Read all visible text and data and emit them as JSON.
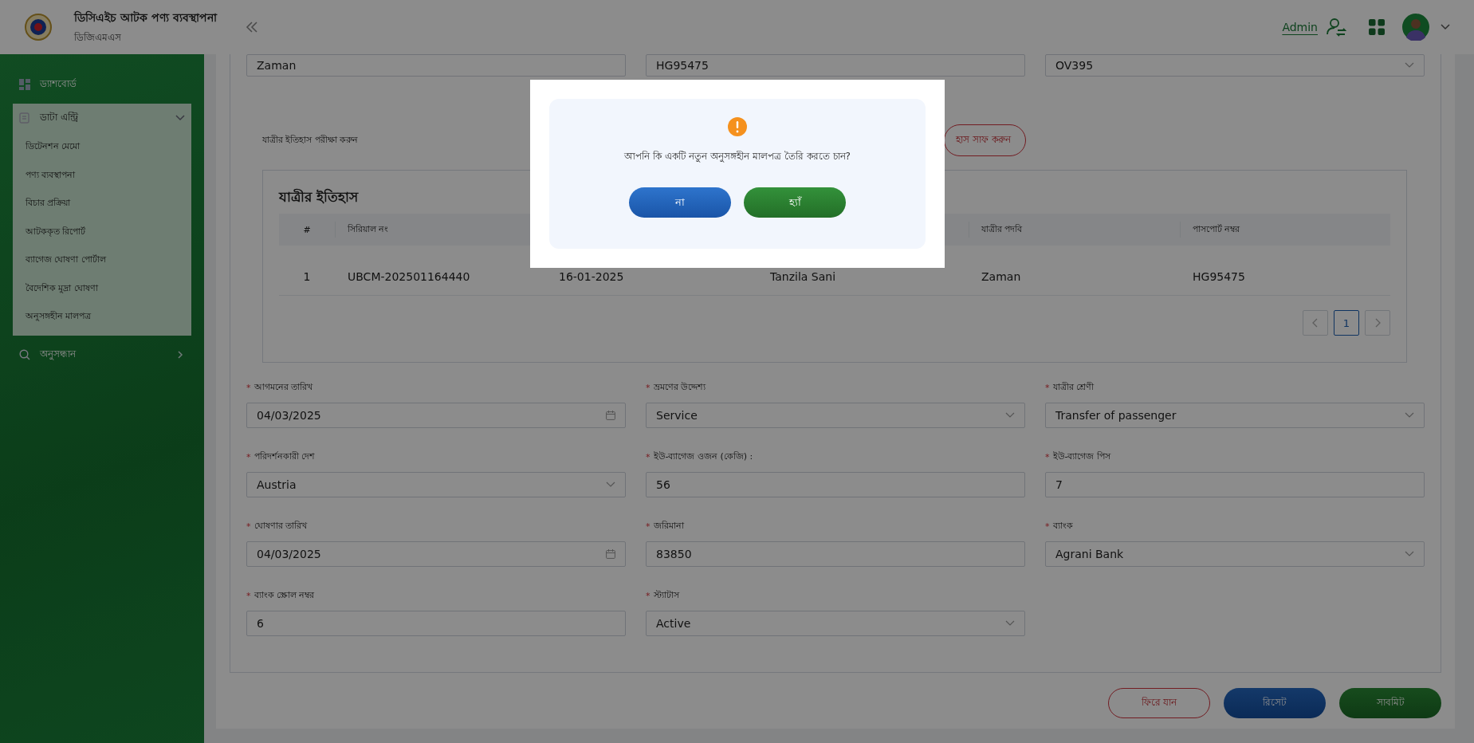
{
  "header": {
    "title": "ডিসিএইচ আটক পণ্য ব্যবস্থাপনা",
    "subtitle": "ডিজিএমএস",
    "user": "Admin"
  },
  "sidebar": {
    "items": [
      {
        "label": "ড্যাশবোর্ড",
        "kind": "dashboard"
      },
      {
        "label": "ডাটা এন্ট্রি",
        "kind": "group",
        "expanded": true,
        "children": [
          {
            "label": "ডিটেনশন মেমো"
          },
          {
            "label": "পণ্য ব্যবস্থাপনা"
          },
          {
            "label": "বিচার প্রক্রিয়া"
          },
          {
            "label": "আটককৃত রিপোর্ট"
          },
          {
            "label": "ব্যাগেজ ঘোষণা পোর্টাল"
          },
          {
            "label": "বৈদেশিক মুদ্রা ঘোষণা"
          },
          {
            "label": "অনুসঙ্গহীন মালপত্র"
          }
        ]
      },
      {
        "label": "অনুসন্ধান",
        "kind": "search",
        "expanded": false
      }
    ]
  },
  "top_fields": [
    {
      "value": "Zaman",
      "kind": "text"
    },
    {
      "value": "HG95475",
      "kind": "text"
    },
    {
      "value": "OV395",
      "kind": "select"
    }
  ],
  "history_check": {
    "label": "যাত্রীর ইতিহাস পরীক্ষা করুন",
    "clear_button": "হাস সাফ করুন"
  },
  "history": {
    "title": "যাত্রীর ইতিহাস",
    "columns": [
      {
        "label": "#"
      },
      {
        "label": "সিরিয়াল নং"
      },
      {},
      {},
      {
        "label": "যাত্রীর পদবি"
      },
      {
        "label": "পাসপোর্ট নম্বর"
      }
    ],
    "rows": [
      [
        "1",
        "UBCM-202501164440",
        "16-01-2025",
        "Tanzila Sani",
        "Zaman",
        "HG95475"
      ]
    ],
    "pages": [
      {
        "label": "1",
        "selected": true
      }
    ]
  },
  "required_mark": "*",
  "form": [
    {
      "label": "আগমনের তারিখ",
      "value": "04/03/2025",
      "kind": "date",
      "required": true
    },
    {
      "label": "ভ্রমণের উদ্দেশ্য",
      "value": "Service",
      "kind": "select",
      "required": true
    },
    {
      "label": "যাত্রীর শ্রেণী",
      "value": "Transfer of passenger",
      "kind": "select",
      "required": true
    },
    {
      "label": "পরিদর্শনকারী দেশ",
      "value": "Austria",
      "kind": "select",
      "required": true
    },
    {
      "label": "ইউ-ব্যাগেজ ওজন (কেজি) :",
      "value": "56",
      "kind": "text",
      "required": true
    },
    {
      "label": "ইউ-ব্যাগেজ পিস",
      "value": "7",
      "kind": "text",
      "required": true
    },
    {
      "label": "ঘোষণার তারিখ",
      "value": "04/03/2025",
      "kind": "date",
      "required": true
    },
    {
      "label": "জরিমানা",
      "value": "83850",
      "kind": "text",
      "required": true
    },
    {
      "label": "ব্যাংক",
      "value": "Agrani Bank",
      "kind": "select",
      "required": true
    },
    {
      "label": "ব্যাংক স্ক্রোল নম্বর",
      "value": "6",
      "kind": "text",
      "required": true
    },
    {
      "label": "স্ট্যাটাস",
      "value": "Active",
      "kind": "select",
      "required": true
    }
  ],
  "actions": [
    {
      "label": "ফিরে যান",
      "kind": "back"
    },
    {
      "label": "রিসেট",
      "kind": "reset"
    },
    {
      "label": "সাবমিট",
      "kind": "submit"
    }
  ],
  "modal": {
    "message": "আপনি কি একটি নতুন অনুসঙ্গহীন মালপত্র তৈরি করতে চান?",
    "buttons": [
      {
        "label": "না",
        "kind": "cancel"
      },
      {
        "label": "হ্যাঁ",
        "kind": "confirm"
      }
    ]
  }
}
